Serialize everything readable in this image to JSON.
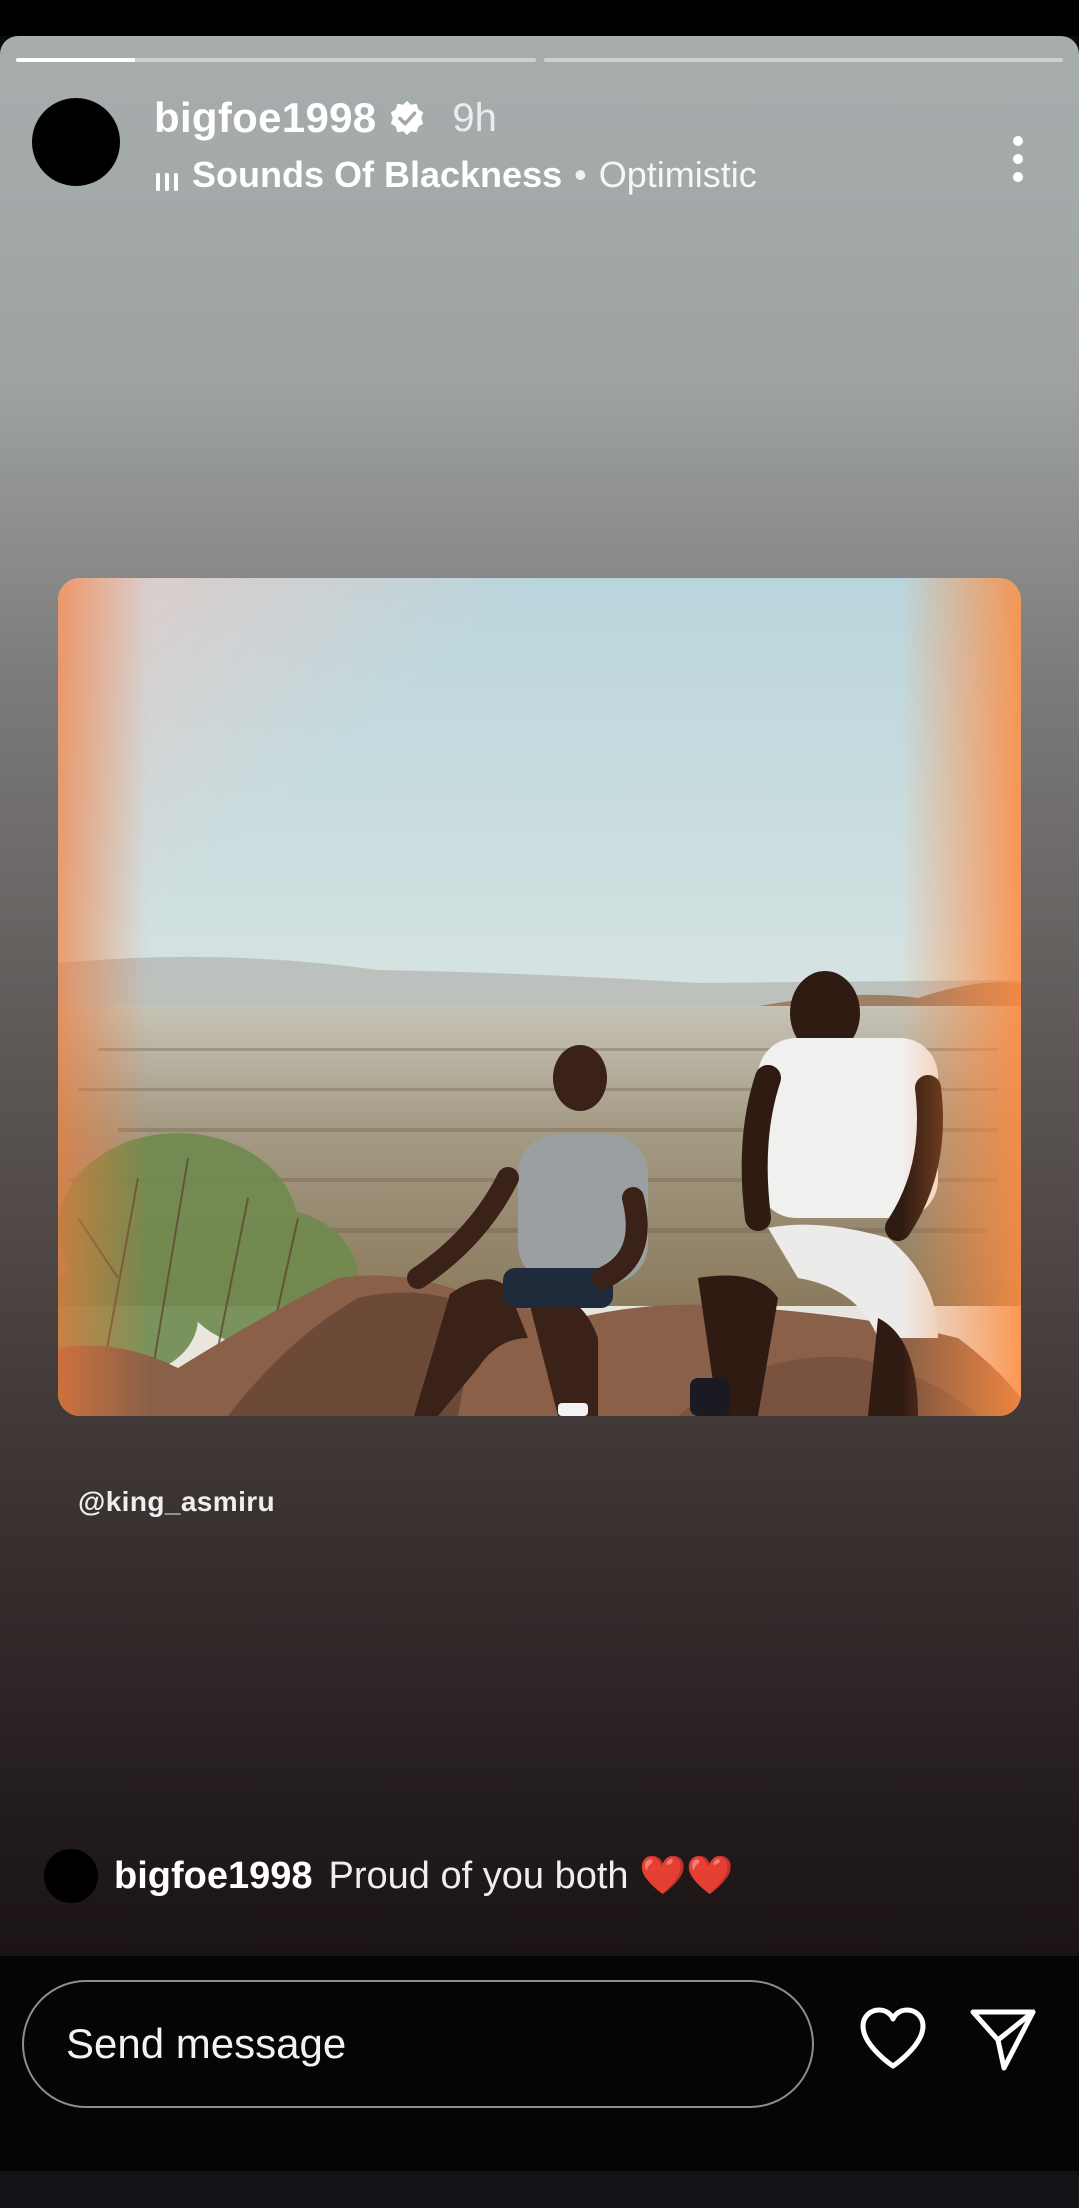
{
  "story": {
    "progress": [
      0.23,
      0
    ],
    "user": {
      "username": "bigfoe1998",
      "verified": true,
      "time": "9h"
    },
    "music": {
      "icon": "music-bars-icon",
      "song": "Sounds Of Blackness",
      "separator": "•",
      "mood": "Optimistic"
    },
    "menu_icon": "more-vertical-icon",
    "photo_credit": "@king_asmiru",
    "caption": {
      "username": "bigfoe1998",
      "text": "Proud of you both ❤️❤️"
    }
  },
  "reply": {
    "placeholder": "Send message",
    "like_icon": "heart-icon",
    "send_icon": "send-icon"
  }
}
